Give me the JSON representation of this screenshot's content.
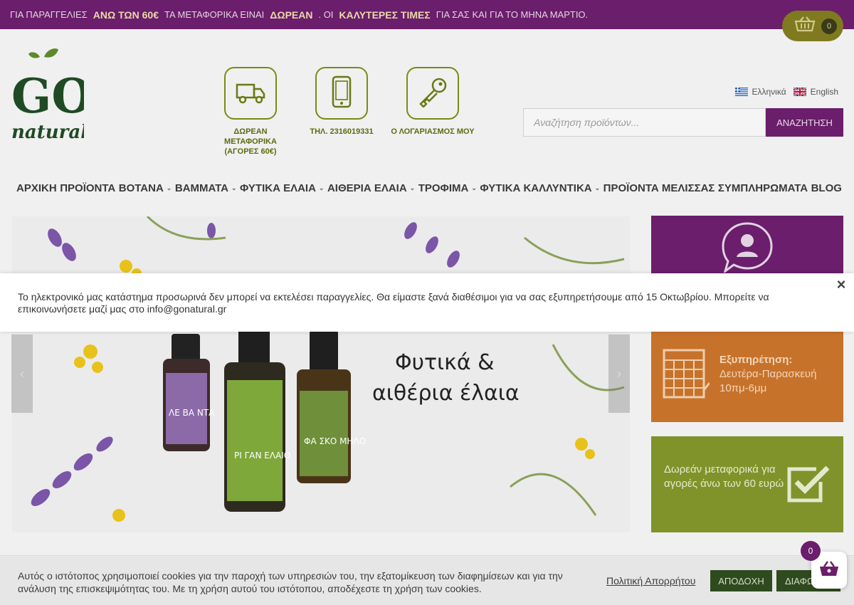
{
  "topbar": {
    "t1": "ΓΙΑ ΠΑΡΑΓΓΕΛΙΕΣ",
    "t2": "ΑΝΩ ΤΩΝ 60€",
    "t3": "ΤΑ ΜΕΤΑΦΟΡΙΚΑ ΕΙΝΑΙ",
    "t4": "ΔΩΡΕΑΝ",
    "t5": ". ΟΙ",
    "t6": "ΚΑΛΥΤΕΡΕΣ ΤΙΜΕΣ",
    "t7": "ΓΙΑ ΣΑΣ ΚΑΙ ΓΙΑ ΤΟ ΜΗΝΑ ΜΑΡΤΙΟ.",
    "cart_count": "0"
  },
  "logo": {
    "line1": "GO",
    "line2": "natural!"
  },
  "features": [
    {
      "icon": "truck-icon",
      "label": "ΔΩΡΕΑΝ ΜΕΤΑΦΟΡΙΚΑ (ΑΓΟΡΕΣ 60€)"
    },
    {
      "icon": "phone-icon",
      "label": "ΤΗΛ. 2316019331"
    },
    {
      "icon": "key-icon",
      "label": "Ο ΛΟΓΑΡΙΑΣΜΟΣ ΜΟΥ"
    }
  ],
  "languages": {
    "greek": "Ελληνικά",
    "english": "English"
  },
  "search": {
    "placeholder": "Αναζήτηση προϊόντων...",
    "button": "ΑΝΑΖΗΤΗΣΗ"
  },
  "nav": [
    {
      "label": "ΑΡΧΙΚΗ",
      "dropdown": false
    },
    {
      "label": "ΠΡΟΪΟΝΤΑ",
      "dropdown": false
    },
    {
      "label": "ΒΟΤΑΝΑ",
      "dropdown": true
    },
    {
      "label": "ΒΑΜΜΑΤΑ",
      "dropdown": true
    },
    {
      "label": "ΦΥΤΙΚΑ ΕΛΑΙΑ",
      "dropdown": true
    },
    {
      "label": "ΑΙΘΕΡΙΑ ΕΛΑΙΑ",
      "dropdown": true
    },
    {
      "label": "ΤΡΟΦΙΜΑ",
      "dropdown": true
    },
    {
      "label": "ΦΥΤΙΚΑ ΚΑΛΛΥΝΤΙΚΑ",
      "dropdown": true
    },
    {
      "label": "ΠΡΟΪΟΝΤΑ ΜΕΛΙΣΣΑΣ",
      "dropdown": false
    },
    {
      "label": "ΣΥΜΠΛΗΡΩΜΑΤΑ",
      "dropdown": false
    },
    {
      "label": "BLOG",
      "dropdown": false
    }
  ],
  "hero": {
    "title_line1": "Φυτικά &",
    "title_line2": "αιθέρια έλαια",
    "bottles": [
      {
        "label": "ΛΕ ΒΑ ΝΤΑ",
        "color": "#8c6aa8"
      },
      {
        "label": "ΡΙ ΓΑΝ ΕΛΑΙΟ",
        "color": "#7fa83a"
      },
      {
        "label": "ΦΑ ΣΚΟ ΜΗΛΟ",
        "color": "#6f8f3a"
      }
    ]
  },
  "sidebar": {
    "hours_title": "Εξυπηρέτηση:",
    "hours_line1": "Δευτέρα-Παρασκευή",
    "hours_line2": "10πμ-6μμ",
    "shipping_text": "Δωρεάν μεταφορικά για αγορές άνω των 60 ευρώ"
  },
  "notice": {
    "text": "Το ηλεκτρονικό μας κατάστημα προσωρινά δεν μπορεί να εκτελέσει παραγγελίες. Θα είμαστε ξανά διαθέσιμοι για να σας εξυπηρετήσουμε από 15 Οκτωβρίου. Μπορείτε να επικοινωνήσετε μαζί μας στο info@gonatural.gr",
    "close": "×"
  },
  "cookie": {
    "text": "Αυτός ο ιστότοπος χρησιμοποιεί cookies για την παροχή των υπηρεσιών του, την εξατομίκευση των διαφημίσεων και για την ανάλυση της επισκεψιμότητας του. Με τη χρήση αυτού του ιστότοπου, αποδέχεστε τη χρήση των cookies.",
    "policy": "Πολιτική Απορρήτου",
    "accept": "ΑΠΟΔΟΧΗ",
    "decline": "ΔΙΑΦΩΝΩ"
  },
  "floating_cart": {
    "count": "0"
  },
  "colors": {
    "purple": "#6a1e6b",
    "olive": "#7f7a1f",
    "orange": "#c7722b",
    "green": "#7f932a"
  }
}
